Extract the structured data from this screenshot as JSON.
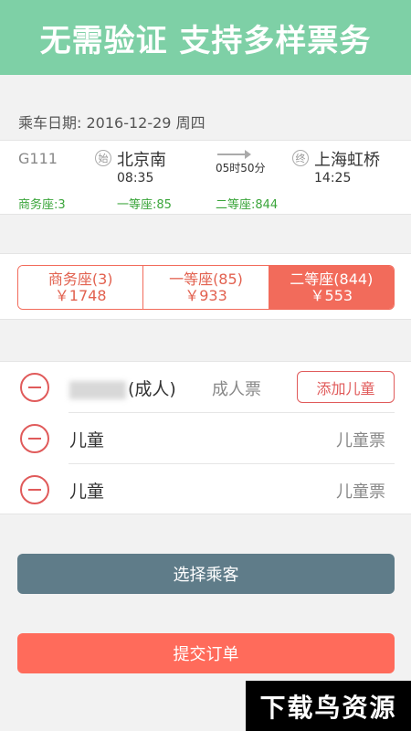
{
  "banner": {
    "title": "无需验证 支持多样票务"
  },
  "trip": {
    "date_label": "乘车日期:",
    "date": "2016-12-29 周四"
  },
  "train": {
    "number": "G111",
    "from_badge": "始",
    "from_station": "北京南",
    "depart_time": "08:35",
    "duration": "05时50分",
    "to_badge": "终",
    "to_station": "上海虹桥",
    "arrive_time": "14:25",
    "availability": [
      {
        "label": "商务座:3"
      },
      {
        "label": "一等座:85"
      },
      {
        "label": "二等座:844"
      }
    ]
  },
  "seat_tabs": [
    {
      "name": "商务座(3)",
      "price": "￥1748",
      "active": false
    },
    {
      "name": "一等座(85)",
      "price": "￥933",
      "active": false
    },
    {
      "name": "二等座(844)",
      "price": "￥553",
      "active": true
    }
  ],
  "passengers": [
    {
      "name_suffix": "(成人)",
      "ticket_type": "成人票",
      "action": "添加儿童"
    },
    {
      "name": "儿童",
      "ticket_type": "儿童票"
    },
    {
      "name": "儿童",
      "ticket_type": "儿童票"
    }
  ],
  "actions": {
    "choose_passenger": "选择乘客",
    "submit_order": "提交订单"
  },
  "watermark": {
    "text": "下载鸟资源"
  },
  "colors": {
    "banner": "#7ed0a6",
    "accent": "#f26b5b",
    "submit": "#ff6b5b",
    "choose": "#5f7c89",
    "availability": "#3aa53a"
  }
}
